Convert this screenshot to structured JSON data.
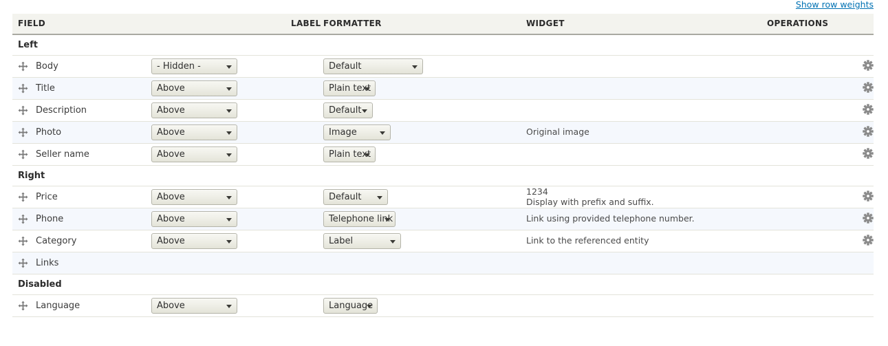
{
  "toolbar": {
    "show_row_weights": "Show row weights"
  },
  "table": {
    "columns": [
      {
        "key": "field",
        "label": "FIELD"
      },
      {
        "key": "label",
        "label": "LABEL"
      },
      {
        "key": "formatter",
        "label": "FORMATTER"
      },
      {
        "key": "widget",
        "label": "WIDGET"
      },
      {
        "key": "operations",
        "label": "OPERATIONS"
      }
    ],
    "icons": {
      "drag": "move-cross-icon",
      "settings": "gear-icon"
    },
    "rows": [
      {
        "type": "region",
        "name": "Left"
      },
      {
        "type": "field",
        "field": "Body",
        "label_value": "- Hidden -",
        "label_width": 125,
        "formatter_value": "Default",
        "formatter_width": 145,
        "widget_lines": [],
        "has_settings": true,
        "stripe": "odd"
      },
      {
        "type": "field",
        "field": "Title",
        "label_value": "Above",
        "label_width": 125,
        "formatter_value": "Plain text",
        "formatter_width": 76,
        "widget_lines": [],
        "has_settings": true,
        "stripe": "even"
      },
      {
        "type": "field",
        "field": "Description",
        "label_value": "Above",
        "label_width": 125,
        "formatter_value": "Default",
        "formatter_width": 72,
        "widget_lines": [],
        "has_settings": true,
        "stripe": "odd"
      },
      {
        "type": "field",
        "field": "Photo",
        "label_value": "Above",
        "label_width": 125,
        "formatter_value": "Image",
        "formatter_width": 98,
        "widget_lines": [
          "Original image"
        ],
        "has_settings": true,
        "stripe": "even"
      },
      {
        "type": "field",
        "field": "Seller name",
        "label_value": "Above",
        "label_width": 125,
        "formatter_value": "Plain text",
        "formatter_width": 76,
        "widget_lines": [],
        "has_settings": true,
        "stripe": "odd"
      },
      {
        "type": "region",
        "name": "Right"
      },
      {
        "type": "field",
        "field": "Price",
        "label_value": "Above",
        "label_width": 125,
        "formatter_value": "Default",
        "formatter_width": 94,
        "widget_lines": [
          "1234",
          "Display with prefix and suffix."
        ],
        "has_settings": true,
        "stripe": "odd"
      },
      {
        "type": "field",
        "field": "Phone",
        "label_value": "Above",
        "label_width": 125,
        "formatter_value": "Telephone link",
        "formatter_width": 105,
        "widget_lines": [
          "Link using provided telephone number."
        ],
        "has_settings": true,
        "stripe": "even"
      },
      {
        "type": "field",
        "field": "Category",
        "label_value": "Above",
        "label_width": 125,
        "formatter_value": "Label",
        "formatter_width": 113,
        "widget_lines": [
          "Link to the referenced entity"
        ],
        "has_settings": true,
        "stripe": "odd"
      },
      {
        "type": "field",
        "field": "Links",
        "label_value": null,
        "formatter_value": null,
        "widget_lines": [],
        "has_settings": false,
        "stripe": "even"
      },
      {
        "type": "region",
        "name": "Disabled"
      },
      {
        "type": "field",
        "field": "Language",
        "label_value": "Above",
        "label_width": 125,
        "formatter_value": "Language",
        "formatter_width": 79,
        "widget_lines": [],
        "has_settings": false,
        "stripe": "odd"
      }
    ]
  },
  "colors": {
    "link": "#0071b3",
    "header_bg": "#f3f3ee",
    "stripe_even": "#f5f8fd",
    "stripe_odd": "#ffffff",
    "border": "#e3e3da",
    "text": "#3b3b3b"
  }
}
